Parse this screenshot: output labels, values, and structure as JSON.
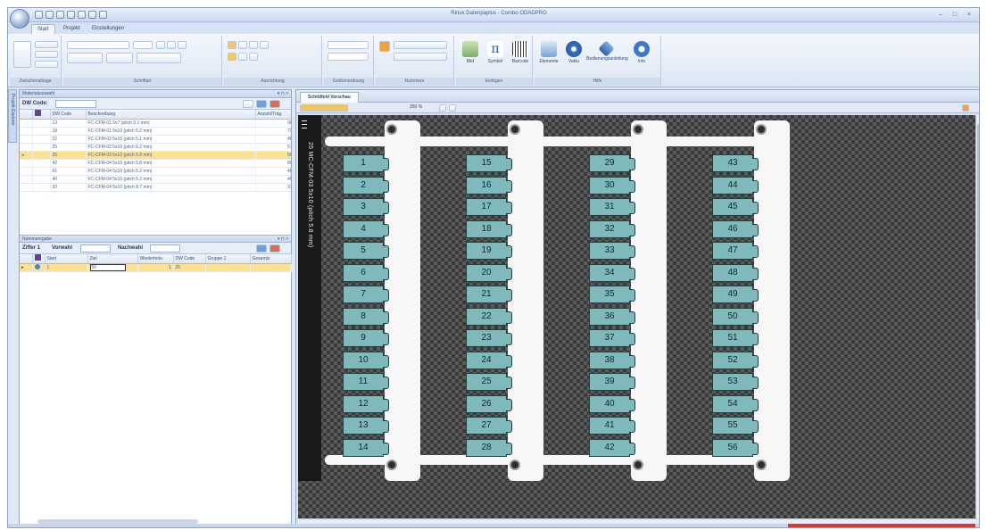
{
  "window": {
    "title": "Rinux Datenpaplus - Combo ODADPRO"
  },
  "tabs": [
    {
      "label": "Start"
    },
    {
      "label": "Projekt"
    },
    {
      "label": "Einstellungen"
    }
  ],
  "ribbon": {
    "groups": [
      {
        "label": "Zwischenablage"
      },
      {
        "label": "Schriftart"
      },
      {
        "label": "Ausrichtung"
      },
      {
        "label": "Größenordnung"
      },
      {
        "label": "Nummern"
      },
      {
        "label": "Einfügen"
      },
      {
        "label": "Hilfe"
      }
    ],
    "insert_buttons": [
      {
        "label": "Bild"
      },
      {
        "label": "Symbol"
      },
      {
        "label": "Barcode"
      }
    ],
    "help_buttons": [
      {
        "label": "Elemente"
      },
      {
        "label": "Vakiu"
      },
      {
        "label": "Bedienungsanleitung"
      },
      {
        "label": "Info"
      }
    ]
  },
  "left_panel": {
    "title": "Materialauswahl",
    "sidetab_label": "Projekt-Explorer",
    "filter_label": "DW Code:",
    "columns": [
      "DW Code",
      "Beschreibung",
      "Anzahl/Träg"
    ],
    "rows": [
      {
        "code": "13",
        "desc": "FC-CFM-01 5x7 (pitch 5.1 mm)",
        "qty": "96"
      },
      {
        "code": "18",
        "desc": "FC-CFM-01 5x10 (pitch 5.2 mm)",
        "qty": "72"
      },
      {
        "code": "22",
        "desc": "FC-CFM-02 5x10 (pitch 5.1 mm)",
        "qty": "48"
      },
      {
        "code": "25",
        "desc": "FC-CFM-02 5x10 (pitch 6.2 mm)",
        "qty": "57"
      },
      {
        "code": "25",
        "desc": "FC-CFM-03 5x10 (pitch 5.8 mm)",
        "qty": "56"
      },
      {
        "code": "42",
        "desc": "FC-CFM-04 5x10 (pitch 5.8 mm)",
        "qty": "80"
      },
      {
        "code": "61",
        "desc": "FC-CFM-04 5x10 (pitch 5.2 mm)",
        "qty": "48"
      },
      {
        "code": "40",
        "desc": "FC-CFM-04 5x10 (pitch 5.2 mm)",
        "qty": "48"
      },
      {
        "code": "32",
        "desc": "FC-CFM-04 5x10 (pitch 8.7 mm)",
        "qty": "32"
      }
    ],
    "selected_row": 4,
    "numbering": {
      "title": "Nummerngabe",
      "toolbar": {
        "ziffer": "Ziffer 1",
        "vorwahl": "Vorwahl",
        "nachwahl": "Nachwahl"
      },
      "columns": [
        "",
        "Start",
        "Ziel",
        "Wiederholu",
        "DW Code",
        "Gruppe 1",
        "Gesamtz"
      ],
      "row": {
        "start": "1",
        "ziel": "56",
        "wiederholung": "1",
        "code": "25"
      }
    }
  },
  "document": {
    "tab_label": "Schildfeld Vorschau",
    "zoom": "250 %",
    "strip_text": "25  MC-CFM-03 5x10  (pitch 5.8 mm)",
    "marker_numbers": [
      [
        "1",
        "2",
        "3",
        "4",
        "5",
        "6",
        "7",
        "8",
        "9",
        "10",
        "11",
        "12",
        "13",
        "14"
      ],
      [
        "15",
        "16",
        "17",
        "18",
        "19",
        "20",
        "21",
        "22",
        "23",
        "24",
        "25",
        "26",
        "27",
        "28"
      ],
      [
        "29",
        "30",
        "31",
        "32",
        "33",
        "34",
        "35",
        "36",
        "37",
        "38",
        "39",
        "40",
        "41",
        "42"
      ],
      [
        "43",
        "44",
        "45",
        "46",
        "47",
        "48",
        "49",
        "50",
        "51",
        "52",
        "53",
        "54",
        "55",
        "56"
      ]
    ]
  },
  "colors": {
    "marker_fill": "#7fb9bb",
    "canvas_dark": "#3a3a3a",
    "selection": "#fde28e"
  }
}
